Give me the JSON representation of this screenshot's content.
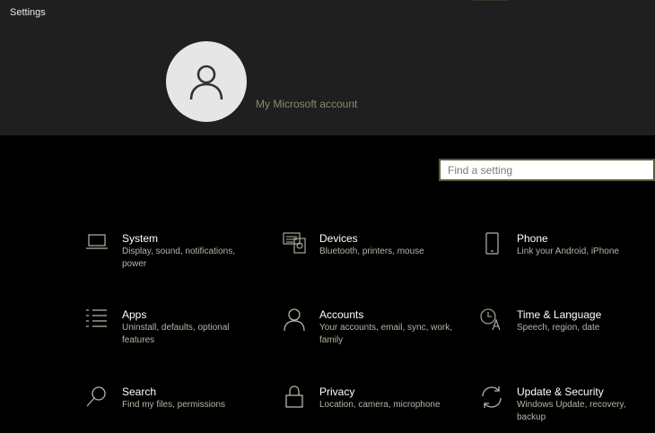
{
  "window": {
    "title": "Settings"
  },
  "account": {
    "link_label": "My Microsoft account"
  },
  "search": {
    "placeholder": "Find a setting",
    "value": ""
  },
  "categories": [
    {
      "name": "System",
      "description": "Display, sound, notifications, power",
      "icon": "laptop-icon"
    },
    {
      "name": "Devices",
      "description": "Bluetooth, printers, mouse",
      "icon": "devices-icon"
    },
    {
      "name": "Phone",
      "description": "Link your Android, iPhone",
      "icon": "phone-icon"
    },
    {
      "name": "Apps",
      "description": "Uninstall, defaults, optional features",
      "icon": "apps-list-icon"
    },
    {
      "name": "Accounts",
      "description": "Your accounts, email, sync, work, family",
      "icon": "person-icon"
    },
    {
      "name": "Time & Language",
      "description": "Speech, region, date",
      "icon": "time-language-icon"
    },
    {
      "name": "Search",
      "description": "Find my files, permissions",
      "icon": "search-icon"
    },
    {
      "name": "Privacy",
      "description": "Location, camera, microphone",
      "icon": "lock-icon"
    },
    {
      "name": "Update & Security",
      "description": "Windows Update, recovery, backup",
      "icon": "sync-icon"
    }
  ],
  "colors": {
    "icon": "#b5b5a5",
    "header_bg": "#1f1f1f",
    "page_bg": "#000000",
    "secondary_text": "#b5b5a5",
    "account_link": "#8a8a6a"
  }
}
